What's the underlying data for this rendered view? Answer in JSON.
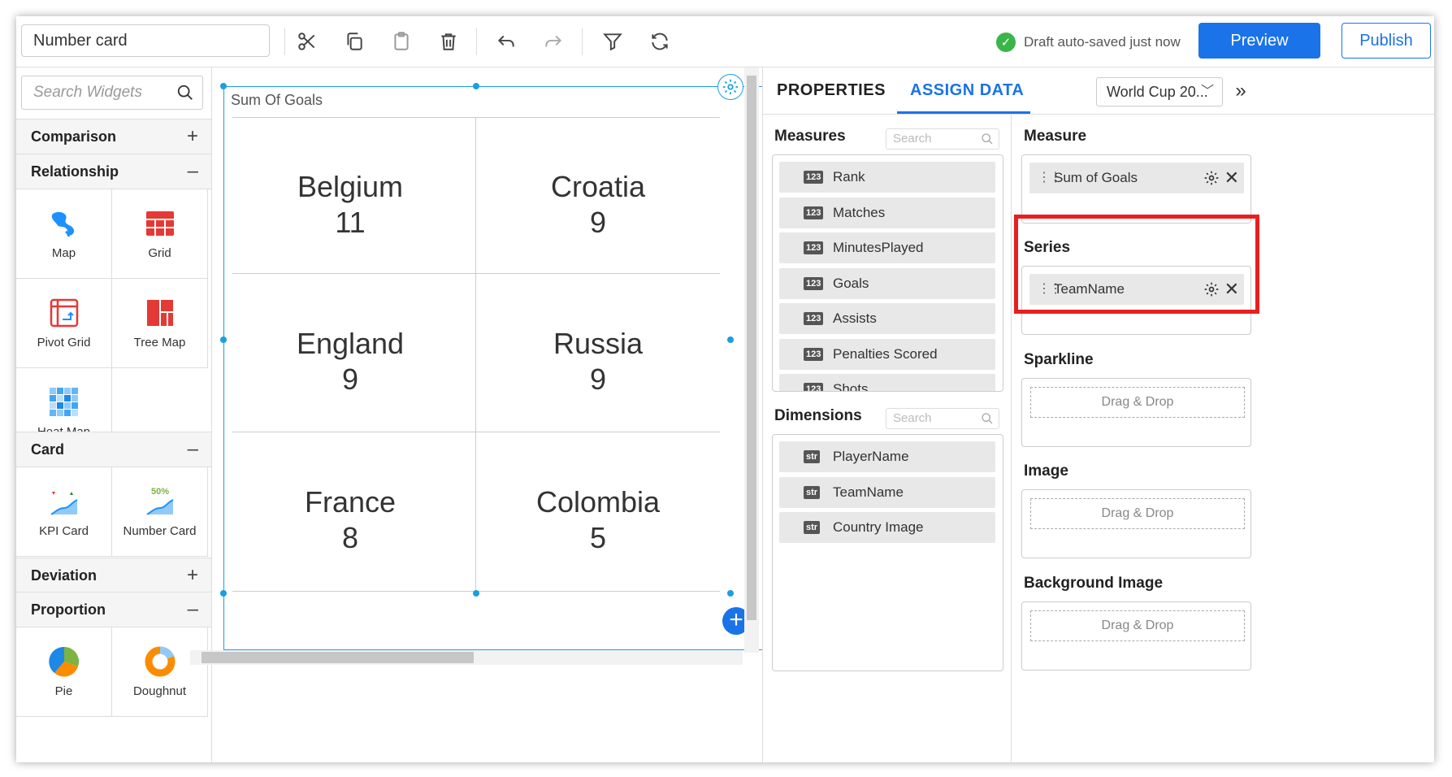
{
  "toolbar": {
    "widget_name": "Number card",
    "status_text": "Draft auto-saved just now",
    "preview_label": "Preview",
    "publish_label": "Publish"
  },
  "left_panel": {
    "search_placeholder": "Search Widgets",
    "categories": [
      {
        "label": "Comparison",
        "sign": "+"
      },
      {
        "label": "Relationship",
        "sign": "–"
      },
      {
        "label": "Card",
        "sign": "–"
      },
      {
        "label": "Deviation",
        "sign": "+"
      },
      {
        "label": "Proportion",
        "sign": "–"
      }
    ],
    "widgets": {
      "map": "Map",
      "grid": "Grid",
      "pivot_grid": "Pivot Grid",
      "tree_map": "Tree Map",
      "heat_map": "Heat Map",
      "kpi_card": "KPI Card",
      "number_card": "Number Card",
      "number_card_badge": "50%",
      "pie": "Pie",
      "doughnut": "Doughnut"
    }
  },
  "canvas": {
    "widget_title": "Sum Of Goals",
    "cards": [
      {
        "team": "Belgium",
        "value": "11"
      },
      {
        "team": "Croatia",
        "value": "9"
      },
      {
        "team": "England",
        "value": "9"
      },
      {
        "team": "Russia",
        "value": "9"
      },
      {
        "team": "France",
        "value": "8"
      },
      {
        "team": "Colombia",
        "value": "5"
      }
    ]
  },
  "right_panel": {
    "tabs": {
      "properties": "PROPERTIES",
      "assign_data": "ASSIGN DATA"
    },
    "datasource": "World Cup 20...",
    "measures_title": "Measures",
    "dimensions_title": "Dimensions",
    "search_placeholder": "Search",
    "measures": [
      {
        "type": "123",
        "label": "Rank"
      },
      {
        "type": "123",
        "label": "Matches"
      },
      {
        "type": "123",
        "label": "MinutesPlayed"
      },
      {
        "type": "123",
        "label": "Goals"
      },
      {
        "type": "123",
        "label": "Assists"
      },
      {
        "type": "123",
        "label": "Penalties Scored"
      },
      {
        "type": "123",
        "label": "Shots"
      }
    ],
    "dimensions": [
      {
        "type": "str",
        "label": "PlayerName"
      },
      {
        "type": "str",
        "label": "TeamName"
      },
      {
        "type": "str",
        "label": "Country Image"
      }
    ],
    "sections": {
      "measure": {
        "title": "Measure",
        "chip": "Sum of Goals"
      },
      "series": {
        "title": "Series",
        "chip": "TeamName"
      },
      "sparkline": {
        "title": "Sparkline",
        "placeholder": "Drag & Drop"
      },
      "image": {
        "title": "Image",
        "placeholder": "Drag & Drop"
      },
      "background_image": {
        "title": "Background Image",
        "placeholder": "Drag & Drop"
      }
    }
  },
  "colors": {
    "accent": "#1a73e8",
    "selection": "#1a9fe0",
    "highlight": "#e81f1f",
    "success": "#3bb54a"
  }
}
